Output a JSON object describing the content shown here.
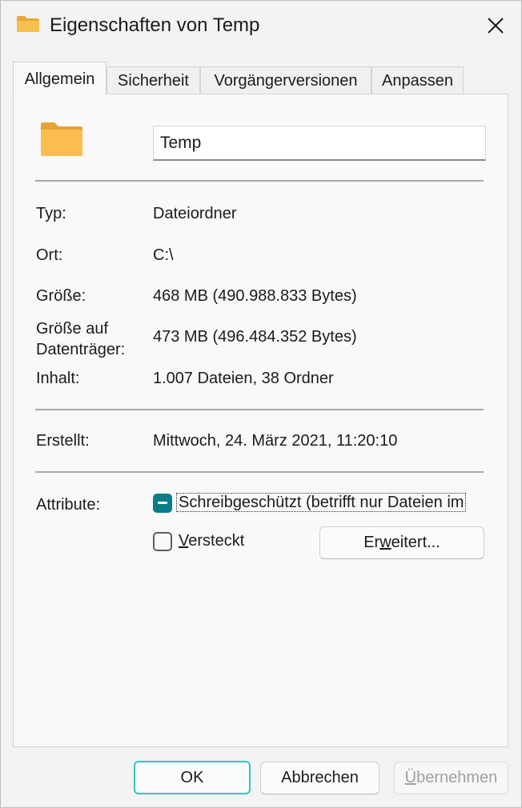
{
  "window": {
    "title": "Eigenschaften von Temp"
  },
  "tabs": [
    {
      "label": "Allgemein"
    },
    {
      "label": "Sicherheit"
    },
    {
      "label": "Vorgängerversionen"
    },
    {
      "label": "Anpassen"
    }
  ],
  "general": {
    "folder_name": "Temp",
    "type": {
      "label": "Typ:",
      "value": "Dateiordner"
    },
    "location": {
      "label": "Ort:",
      "value": "C:\\"
    },
    "size": {
      "label": "Größe:",
      "value": "468 MB (490.988.833 Bytes)"
    },
    "size_on_disk": {
      "label_line1": "Größe auf",
      "label_line2": "Datenträger:",
      "value": "473 MB (496.484.352 Bytes)"
    },
    "contents": {
      "label": "Inhalt:",
      "value": "1.007 Dateien, 38 Ordner"
    },
    "created": {
      "label": "Erstellt:",
      "value": "Mittwoch, 24. März 2021, 11:20:10"
    },
    "attributes": {
      "label": "Attribute:",
      "readonly": {
        "label": "Schreibgeschützt (betrifft nur Dateien im",
        "state": "indeterminate"
      },
      "hidden": {
        "label_pre": "",
        "label_accel": "V",
        "label_post": "ersteckt",
        "checked": false
      },
      "advanced_button": {
        "label_pre": "Er",
        "label_accel": "w",
        "label_post": "eitert..."
      }
    }
  },
  "buttons": {
    "ok": "OK",
    "cancel": "Abbrechen",
    "apply": {
      "label_pre": "",
      "label_accel": "Ü",
      "label_post": "bernehmen",
      "enabled": false
    }
  },
  "colors": {
    "accent": "#0a7d8a",
    "focus_border": "#36c3c0",
    "folder": "#f7b64a"
  },
  "icons": [
    "folder-icon",
    "close-icon",
    "folder-large-icon"
  ]
}
